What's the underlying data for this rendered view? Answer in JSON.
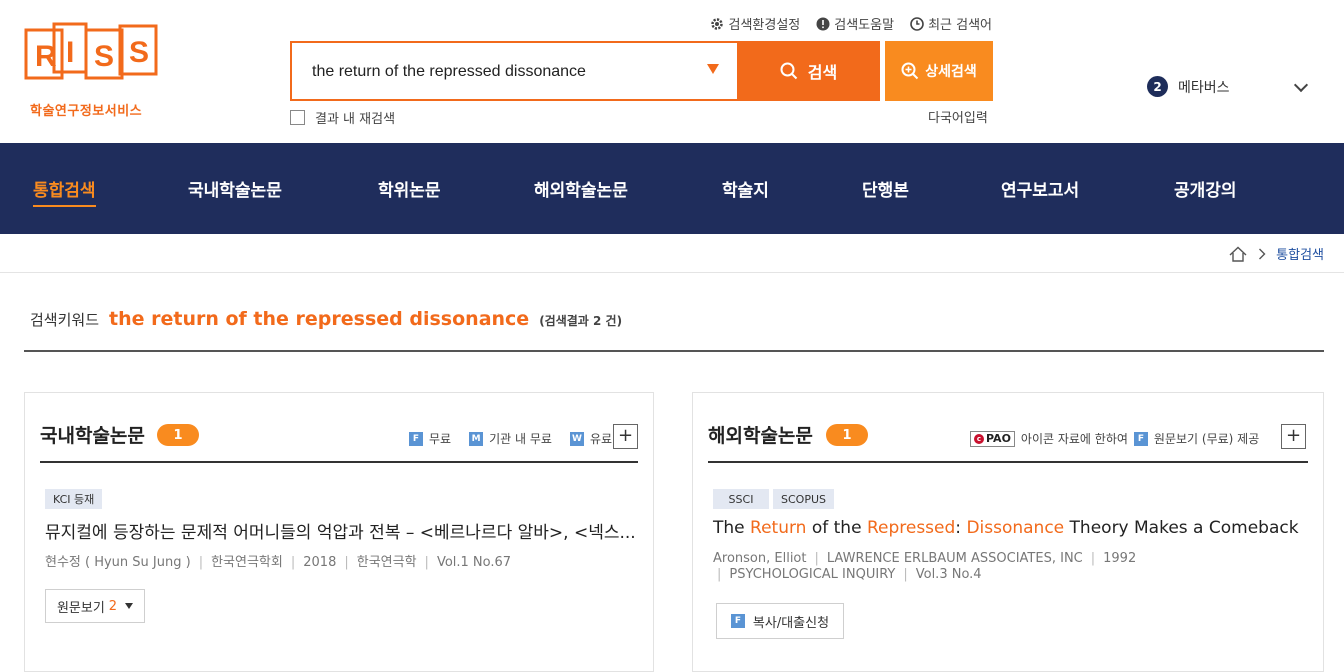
{
  "logo": {
    "text": "RISS",
    "subtitle": "학술연구정보서비스"
  },
  "top_links": [
    {
      "label": "검색환경설정",
      "icon": "gear-icon"
    },
    {
      "label": "검색도움말",
      "icon": "help-icon"
    },
    {
      "label": "최근 검색어",
      "icon": "clock-icon"
    }
  ],
  "search": {
    "value": "the return of the repressed dissonance",
    "button_label": "검색",
    "advanced_label": "상세검색",
    "recheck_label": "결과 내 재검색",
    "multilang_label": "다국어입력"
  },
  "metaverse": {
    "badge": "2",
    "label": "메타버스"
  },
  "nav": {
    "items": [
      "통합검색",
      "국내학술논문",
      "학위논문",
      "해외학술논문",
      "학술지",
      "단행본",
      "연구보고서",
      "공개강의"
    ],
    "active_index": 0
  },
  "breadcrumb": {
    "current": "통합검색"
  },
  "keyword": {
    "label": "검색키워드",
    "term": "the return of the repressed dissonance",
    "count_text": "(검색결과 2 건)"
  },
  "domestic": {
    "title": "국내학술논문",
    "count": "1",
    "legend": [
      {
        "letter": "F",
        "label": "무료"
      },
      {
        "letter": "M",
        "label": "기관 내 무료"
      },
      {
        "letter": "W",
        "label": "유료"
      }
    ],
    "result": {
      "tag": "KCI 등재",
      "title": "뮤지컬에 등장하는 문제적 어머니들의 억압과 전복 – <베르나르다 알바>, <넥스...",
      "author": "현수정 ( Hyun Su Jung )",
      "publisher": "한국연극학회",
      "year": "2018",
      "journal": "한국연극학",
      "volume": "Vol.1 No.67",
      "view_label": "원문보기",
      "view_count": "2"
    }
  },
  "foreign": {
    "title": "해외학술논문",
    "count": "1",
    "pao_label": "PAO",
    "legend_text1": "아이콘 자료에 한하여",
    "legend_letter": "F",
    "legend_text2": "원문보기 (무료) 제공",
    "result": {
      "tags": [
        "SSCI",
        "SCOPUS"
      ],
      "title_parts": [
        {
          "text": "The ",
          "hl": false
        },
        {
          "text": "Return",
          "hl": true
        },
        {
          "text": " of the ",
          "hl": false
        },
        {
          "text": "Repressed",
          "hl": true
        },
        {
          "text": ": ",
          "hl": false
        },
        {
          "text": "Dissonance",
          "hl": true
        },
        {
          "text": " Theory Makes a Comeback",
          "hl": false
        }
      ],
      "author": "Aronson, Elliot",
      "publisher": "LAWRENCE ERLBAUM ASSOCIATES, INC",
      "year": "1992",
      "journal": "PSYCHOLOGICAL INQUIRY",
      "volume": "Vol.3 No.4",
      "copy_letter": "F",
      "copy_label": "복사/대출신청"
    }
  },
  "colors": {
    "accent": "#f26a1b",
    "accent_light": "#f98b1f",
    "navy": "#1f2d5c"
  }
}
